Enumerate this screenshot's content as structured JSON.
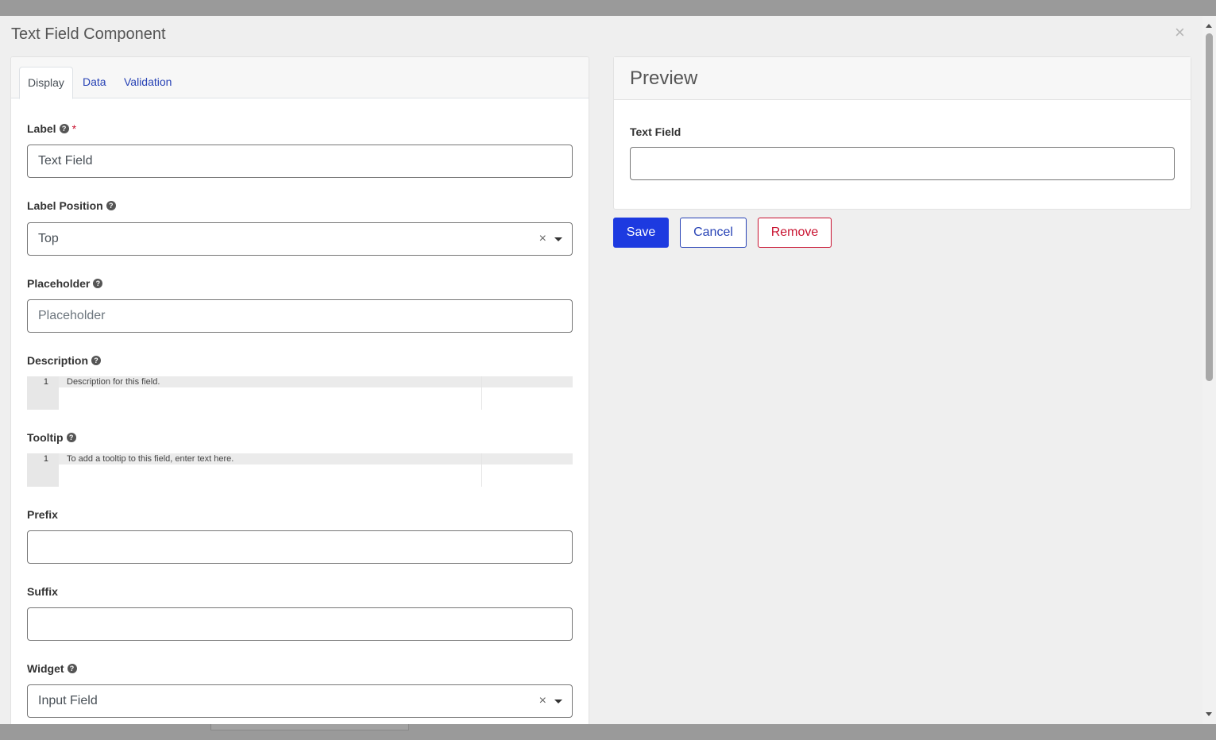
{
  "modal": {
    "title": "Text Field Component",
    "close_symbol": "×"
  },
  "tabs": [
    {
      "label": "Display",
      "active": true
    },
    {
      "label": "Data",
      "active": false
    },
    {
      "label": "Validation",
      "active": false
    }
  ],
  "form": {
    "label": {
      "title": "Label",
      "required_mark": "*",
      "value": "Text Field"
    },
    "label_position": {
      "title": "Label Position",
      "value": "Top"
    },
    "placeholder": {
      "title": "Placeholder",
      "placeholder": "Placeholder"
    },
    "description": {
      "title": "Description",
      "line_number": "1",
      "text": "Description for this field."
    },
    "tooltip": {
      "title": "Tooltip",
      "line_number": "1",
      "text": "To add a tooltip to this field, enter text here."
    },
    "prefix": {
      "title": "Prefix",
      "value": ""
    },
    "suffix": {
      "title": "Suffix",
      "value": ""
    },
    "widget": {
      "title": "Widget",
      "value": "Input Field"
    }
  },
  "preview": {
    "title": "Preview",
    "field_label": "Text Field",
    "field_value": ""
  },
  "buttons": {
    "save": "Save",
    "cancel": "Cancel",
    "remove": "Remove"
  },
  "icons": {
    "help": "question-circle-icon",
    "clear": "×"
  },
  "colors": {
    "primary": "#1d3ae0",
    "link": "#2742b5",
    "danger": "#c8102e",
    "overlay": "#9a9a9a",
    "modal_bg": "#efefef"
  }
}
